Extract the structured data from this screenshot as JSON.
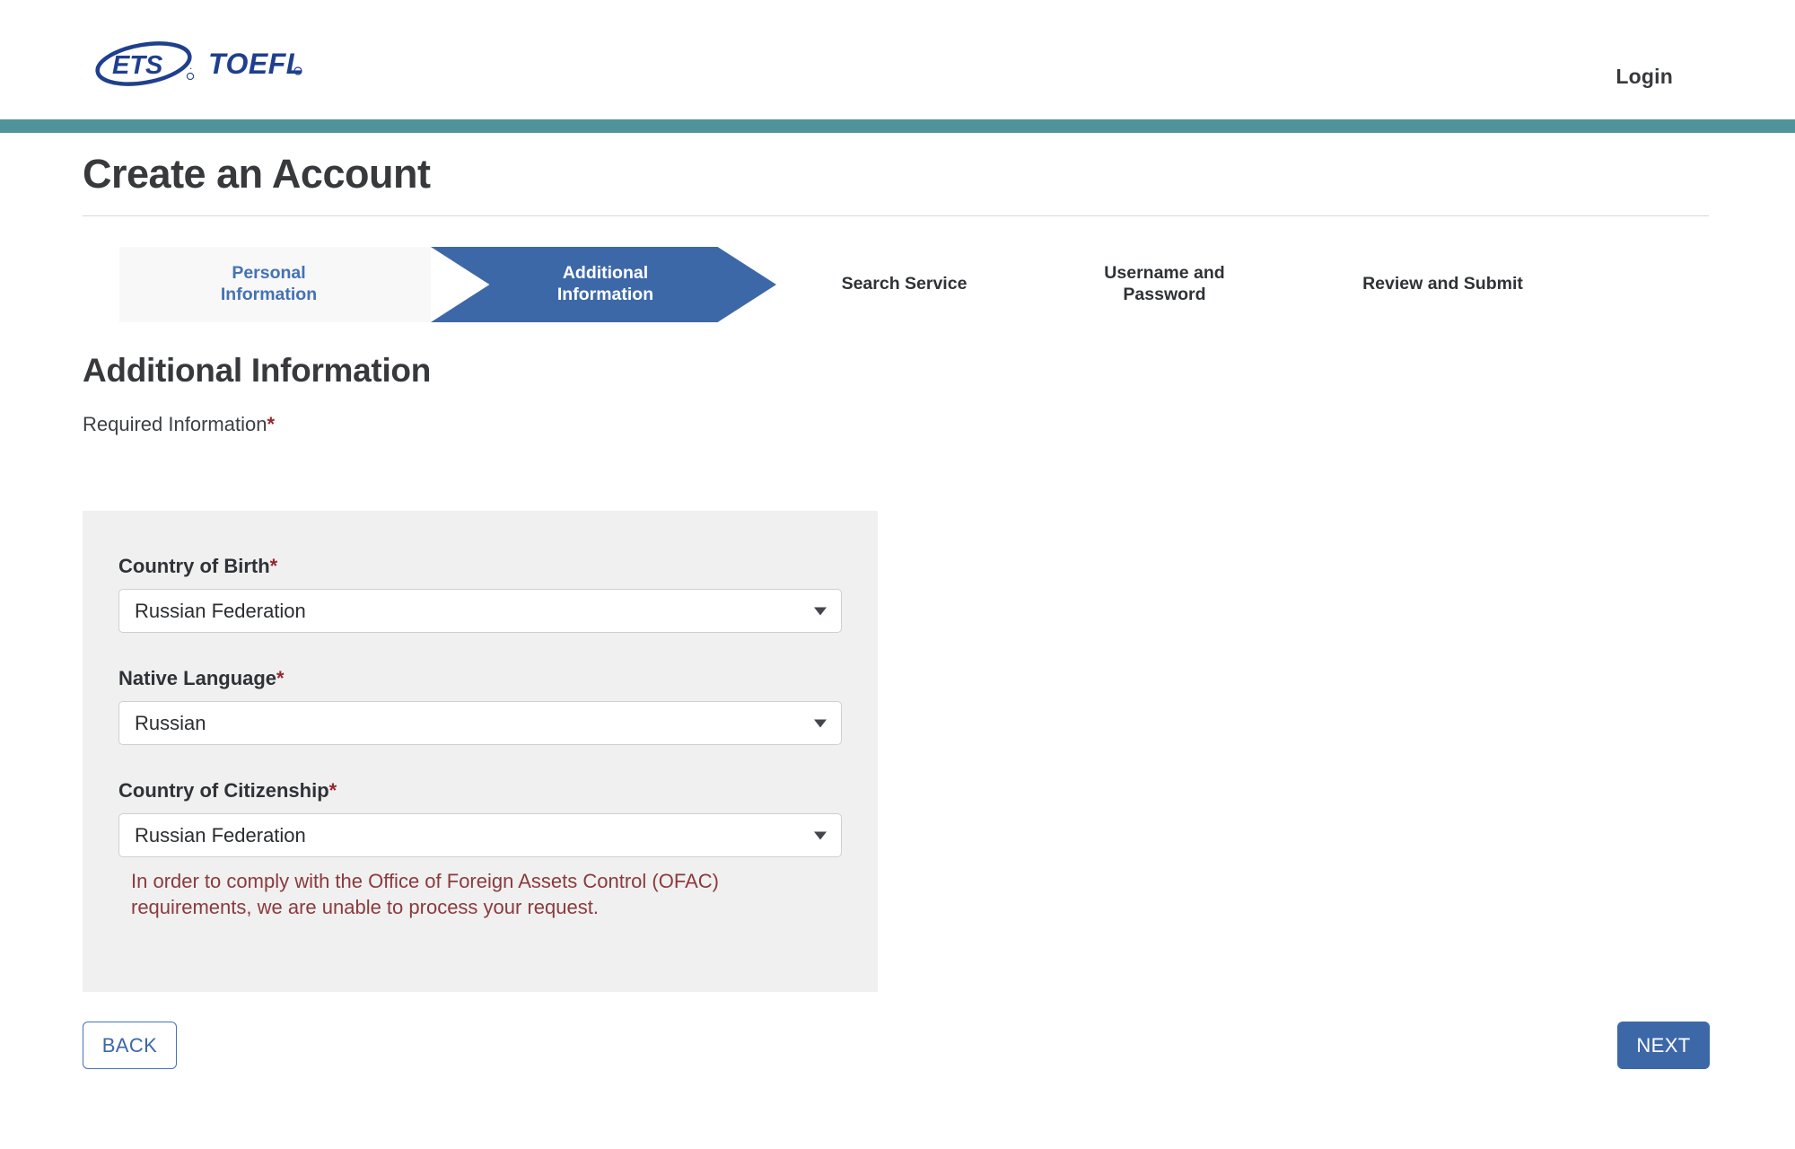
{
  "header": {
    "logo_primary": "ETS",
    "logo_secondary": "TOEFL",
    "logo_registered_mark": "®",
    "login_label": "Login",
    "accent_teal": "#4f939b"
  },
  "page": {
    "title": "Create an Account",
    "brand_blue": "#3d68a8",
    "required_star_color": "#96272d"
  },
  "steps": [
    {
      "label_line1": "Personal",
      "label_line2": "Information",
      "state": "completed"
    },
    {
      "label_line1": "Additional",
      "label_line2": "Information",
      "state": "active"
    },
    {
      "label_line1": "Search Service",
      "label_line2": "",
      "state": "upcoming"
    },
    {
      "label_line1": "Username and",
      "label_line2": "Password",
      "state": "upcoming"
    },
    {
      "label_line1": "Review and Submit",
      "label_line2": "",
      "state": "upcoming"
    }
  ],
  "section": {
    "heading": "Additional Information",
    "required_text": "Required Information",
    "required_marker": "*"
  },
  "form": {
    "fields": [
      {
        "label": "Country of Birth",
        "marker": "*",
        "value": "Russian Federation",
        "caret": "chevron-down-icon",
        "error": ""
      },
      {
        "label": "Native Language",
        "marker": "*",
        "value": "Russian",
        "caret": "chevron-down-icon",
        "error": ""
      },
      {
        "label": "Country of Citizenship",
        "marker": "*",
        "value": "Russian Federation",
        "caret": "chevron-down-icon",
        "error": "In order to comply with the Office of Foreign Assets Control (OFAC) requirements, we are unable to process your request."
      }
    ]
  },
  "footer": {
    "back_label": "BACK",
    "next_label": "NEXT"
  }
}
